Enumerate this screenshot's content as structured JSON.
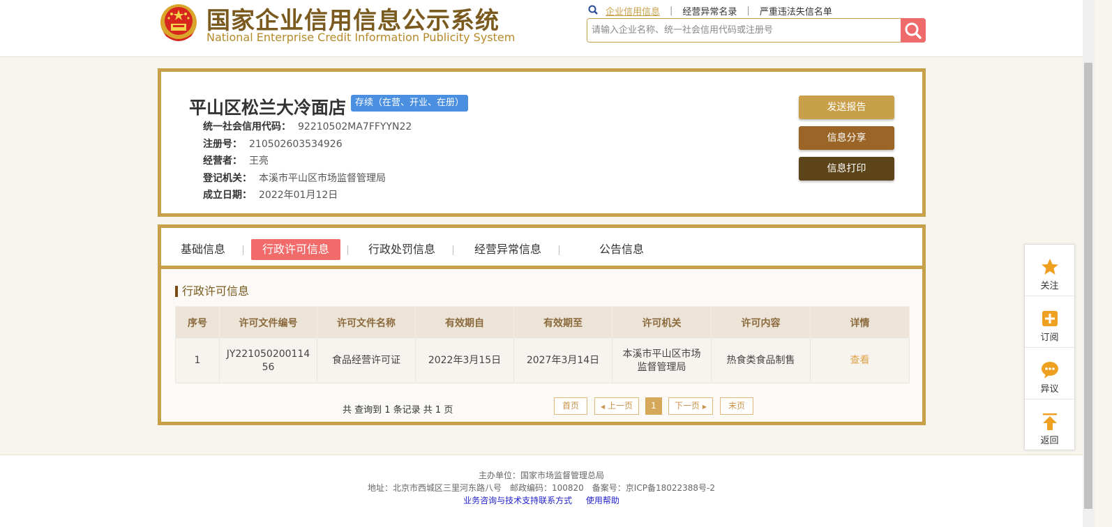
{
  "header": {
    "title_cn": "国家企业信用信息公示系统",
    "title_en": "National Enterprise Credit Information Publicity System",
    "nav": [
      "企业信用信息",
      "经营异常名录",
      "严重违法失信名单"
    ],
    "search_placeholder": "请输入企业名称、统一社会信用代码或注册号"
  },
  "enterprise": {
    "name": "平山区松兰大冷面店",
    "status": "存续（在营、开业、在册）",
    "fields": [
      {
        "label": "统一社会信用代码：",
        "value": "92210502MA7FFYYN22"
      },
      {
        "label": "注册号：",
        "value": "210502603534926"
      },
      {
        "label": "经营者：",
        "value": "王亮"
      },
      {
        "label": "登记机关：",
        "value": "本溪市平山区市场监督管理局"
      },
      {
        "label": "成立日期：",
        "value": "2022年01月12日"
      }
    ],
    "actions": [
      "发送报告",
      "信息分享",
      "信息打印"
    ]
  },
  "tabs": [
    "基础信息",
    "行政许可信息",
    "行政处罚信息",
    "经营异常信息",
    "公告信息"
  ],
  "section_title": "行政许可信息",
  "table": {
    "headers": [
      "序号",
      "许可文件编号",
      "许可文件名称",
      "有效期自",
      "有效期至",
      "许可机关",
      "许可内容",
      "详情"
    ],
    "rows": [
      [
        "1",
        "JY22105020011456",
        "食品经营许可证",
        "2022年3月15日",
        "2027年3月14日",
        "本溪市平山区市场监督管理局",
        "热食类食品制售",
        "查看"
      ]
    ]
  },
  "pager": {
    "total": "共 查询到 1 条记录 共 1 页",
    "first": "首页",
    "prev": "上一页",
    "current": "1",
    "next": "下一页",
    "last": "末页"
  },
  "footer": {
    "sponsor": "主办单位：国家市场监督管理总局",
    "address": "地址：北京市西城区三里河东路八号　邮政编码：100820　备案号：京ICP备18022388号-2",
    "link1": "业务咨询与技术支持联系方式",
    "link2": "使用帮助"
  },
  "sidebar": [
    "关注",
    "订阅",
    "异议",
    "返回"
  ],
  "colors": {
    "gold": "#c9a04a",
    "tab_active": "#f26b6b",
    "badge": "#4a8fe0",
    "btn1": "#c9a04a",
    "btn2": "#9a6526",
    "btn3": "#5e4519"
  }
}
